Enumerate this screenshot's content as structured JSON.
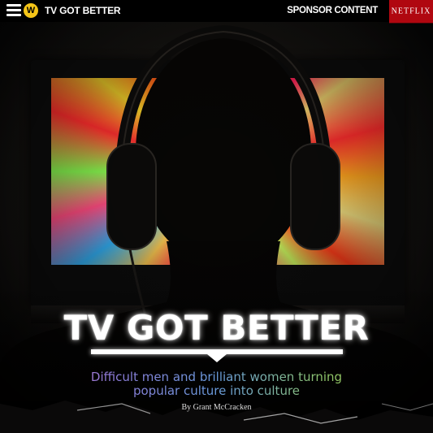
{
  "header": {
    "logo_letter": "W",
    "site_title": "TV GOT BETTER",
    "sponsor_label": "SPONSOR CONTENT",
    "sponsor_brand": "NETFLIX",
    "sponsor_brand_color": "#b00710",
    "logo_color": "#f5c518",
    "menu_icon": "hamburger-icon"
  },
  "hero": {
    "title": "TV GOT BETTER",
    "subtitle_line1": "Difficult men and brilliant women turning",
    "subtitle_line2": "popular culture into culture",
    "byline": "By Grant McCracken",
    "image_subject": "silhouette-with-headphones-watching-tv"
  }
}
